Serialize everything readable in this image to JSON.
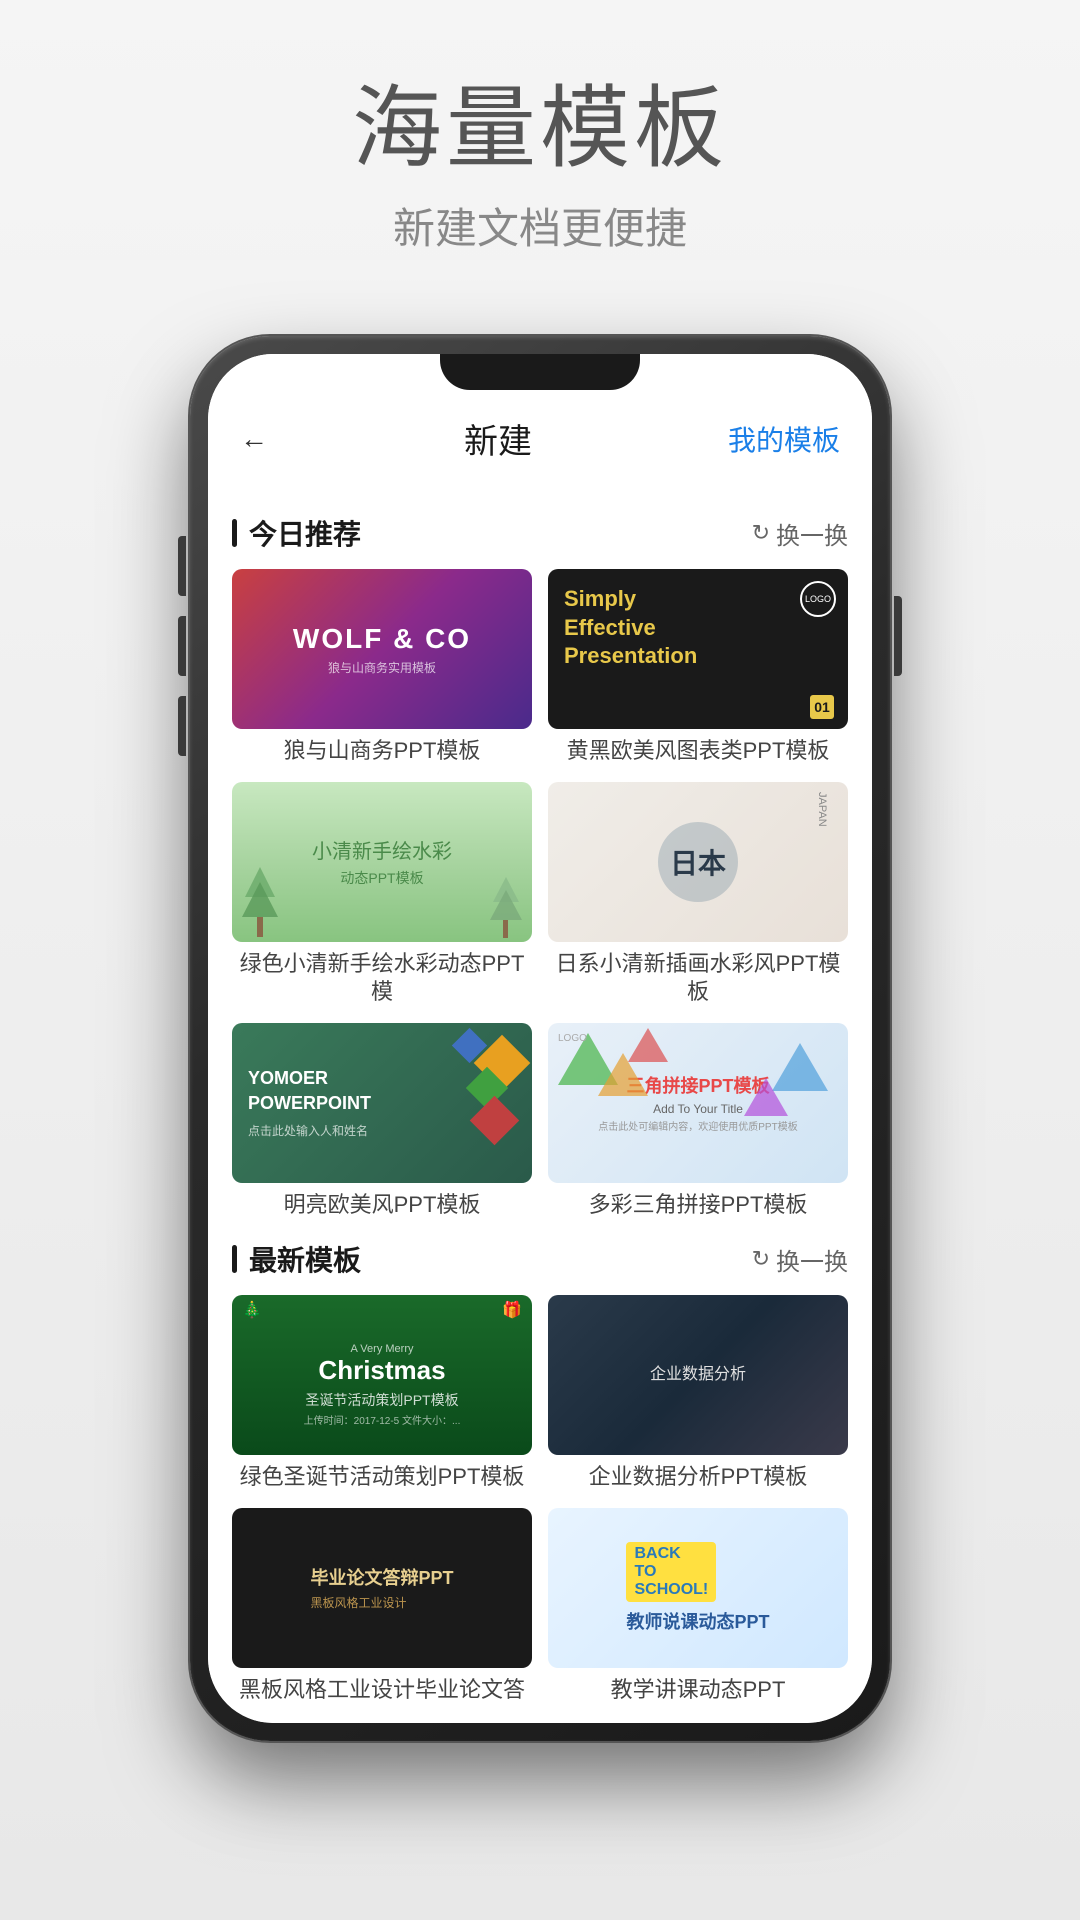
{
  "header": {
    "title": "海量模板",
    "subtitle": "新建文档更便捷"
  },
  "appBar": {
    "back": "←",
    "pageTitle": "新建",
    "myTemplates": "我的模板"
  },
  "todaySection": {
    "title": "今日推荐",
    "refresh": "换一换",
    "templates": [
      {
        "id": "wolf",
        "label": "狼与山商务PPT模板",
        "wolfTitle": "WOLF & CO",
        "wolfSub": "狼与山商务实用模板"
      },
      {
        "id": "dark",
        "label": "黄黑欧美风图表类PPT模板",
        "darkLine1": "Simply",
        "darkLine2": "Effective",
        "darkLine3": "Presentation",
        "darkLogoText": "LOGO",
        "darkPageNum": "01"
      },
      {
        "id": "watercolor",
        "label": "绿色小清新手绘水彩动态PPT模",
        "watercolorMain": "小清新手绘水彩",
        "watercolorSub": "动态PPT模板"
      },
      {
        "id": "japan",
        "label": "日系小清新插画水彩风PPT模板",
        "japanChar1": "日",
        "japanChar2": "本",
        "japanSide": "JAPAN"
      },
      {
        "id": "bright",
        "label": "明亮欧美风PPT模板",
        "brightTitle": "YOMOER\nPOWERPOINT",
        "brightSub": "点击此处输入人和姓名"
      },
      {
        "id": "triangle",
        "label": "多彩三角拼接PPT模板",
        "triLogo": "LOGO",
        "triTitle": "三角拼接PPT模板",
        "triSub": "Add To Your Title",
        "triDesc": "点击此处可编辑内容，欢迎使用优质PPT模板"
      }
    ]
  },
  "latestSection": {
    "title": "最新模板",
    "refresh": "换一换",
    "templates": [
      {
        "id": "christmas",
        "label": "绿色圣诞节活动策划PPT模板",
        "christmasMain": "Christmas",
        "christmasSub": "圣诞节活动策划PPT模板",
        "christmasDesc": "上传时间：2017-12-5    文件大小：..."
      },
      {
        "id": "dataanalysis",
        "label": "企业数据分析PPT模板",
        "dataTitle": "企业数据分析"
      },
      {
        "id": "blackboard",
        "label": "黑板风格工业设计毕业论文答",
        "blackboardMain": "毕业论文答辩PPT",
        "blackboardSub": "黑板风格工业设计"
      },
      {
        "id": "school",
        "label": "教学讲课动态PPT",
        "schoolMain": "教师说课动态PPT",
        "schoolSub": "BACK TO SCHOOL!"
      }
    ]
  }
}
